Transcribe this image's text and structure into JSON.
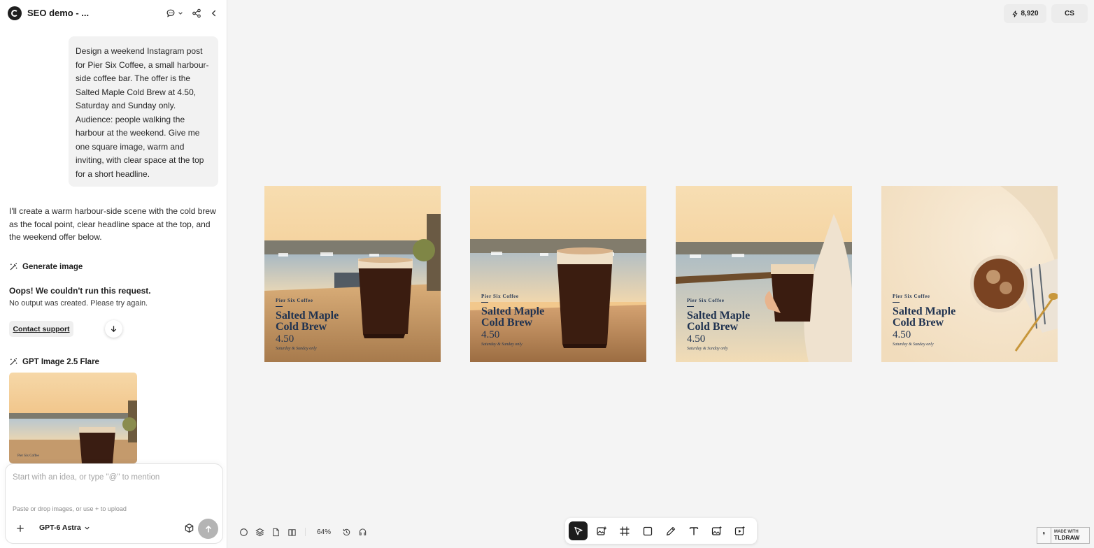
{
  "header": {
    "project_title": "SEO demo - ...",
    "credits": "8,920",
    "avatar_initials": "CS"
  },
  "chat": {
    "user_prompt": "Design a weekend Instagram post for Pier Six Coffee, a small harbour-side coffee bar. The offer is the Salted Maple Cold Brew at 4.50, Saturday and Sunday only. Audience: people walking the harbour at the weekend. Give me one square image, warm and inviting, with clear space at the top for a short headline.",
    "assistant_reply": "I'll create a warm harbour-side scene with the cold brew as the focal point, clear headline space at the top, and the weekend offer below.",
    "tool_generate_label": "Generate image",
    "error_title": "Oops! We couldn't run this request.",
    "error_subtitle": "No output was created. Please try again.",
    "contact_support_label": "Contact support",
    "tool_model_label": "GPT Image 2.5 Flare"
  },
  "composer": {
    "placeholder": "Start with an idea, or type \"@\" to mention",
    "upload_hint": "Paste or drop images, or use + to upload",
    "model_name": "GPT-6 Astra"
  },
  "canvas": {
    "zoom": "64%",
    "cards": [
      {
        "brand": "Pier Six Coffee",
        "headline_line1": "Salted Maple",
        "headline_line2": "Cold Brew",
        "price": "4.50",
        "note": "Saturday & Sunday only"
      },
      {
        "brand": "Pier Six Coffee",
        "headline_line1": "Salted Maple",
        "headline_line2": "Cold Brew",
        "price": "4.50",
        "note": "Saturday & Sunday only"
      },
      {
        "brand": "Pier Six Coffee",
        "headline_line1": "Salted Maple",
        "headline_line2": "Cold Brew",
        "price": "4.50",
        "note": "Saturday & Sunday only"
      },
      {
        "brand": "Pier Six Coffee",
        "headline_line1": "Salted Maple",
        "headline_line2": "Cold Brew",
        "price": "4.50",
        "note": "Saturday & Sunday only"
      }
    ]
  },
  "toolbar": {
    "tools": [
      "select-icon",
      "image-add-icon",
      "frame-icon",
      "rectangle-icon",
      "pencil-icon",
      "text-icon",
      "image-generate-icon",
      "video-generate-icon"
    ],
    "active_tool": "select-icon"
  },
  "badge": {
    "line1": "MADE WITH",
    "line2": "TLDRAW"
  },
  "colors": {
    "navy_text": "#1f3250",
    "send_button": "#b4b4b4",
    "active_tool_bg": "#1d1d1d"
  }
}
